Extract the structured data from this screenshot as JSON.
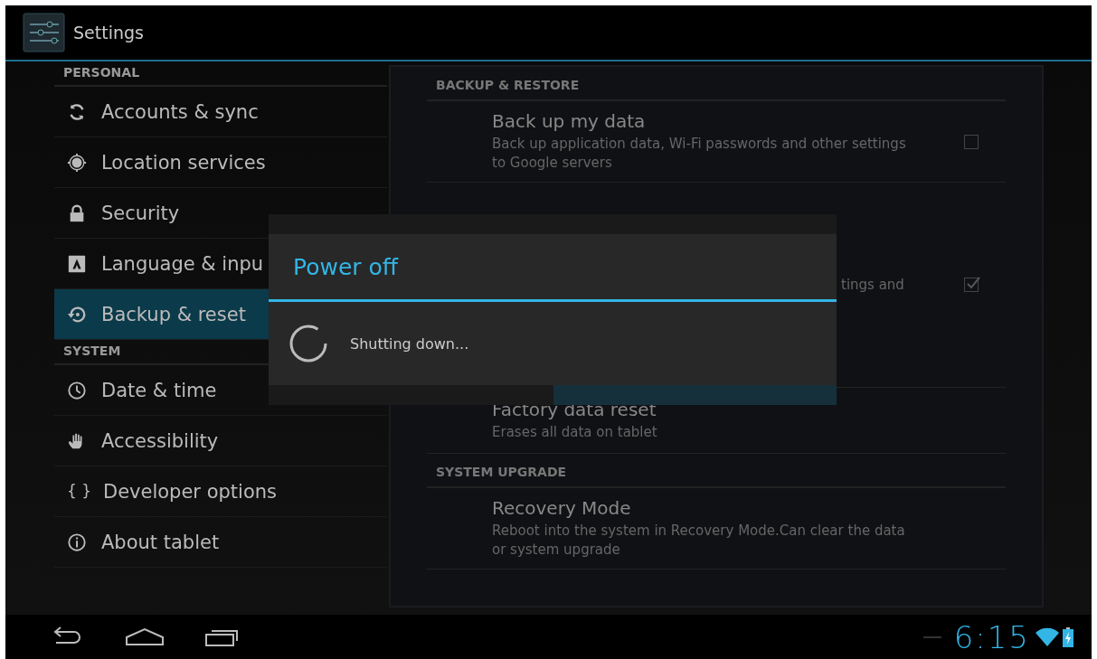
{
  "action_bar": {
    "title": "Settings"
  },
  "sidebar": {
    "sections": [
      {
        "header": "PERSONAL",
        "items": [
          {
            "label": "Accounts & sync",
            "selected": false
          },
          {
            "label": "Location services",
            "selected": false
          },
          {
            "label": "Security",
            "selected": false
          },
          {
            "label": "Language & inpu",
            "selected": false
          },
          {
            "label": "Backup & reset",
            "selected": true
          }
        ]
      },
      {
        "header": "SYSTEM",
        "items": [
          {
            "label": "Date & time",
            "selected": false
          },
          {
            "label": "Accessibility",
            "selected": false
          },
          {
            "glyph": "{ }",
            "label": "Developer options",
            "selected": false
          },
          {
            "label": "About tablet",
            "selected": false
          }
        ]
      }
    ]
  },
  "detail": {
    "sections": [
      {
        "header": "BACKUP & RESTORE",
        "rows": [
          {
            "kind": "checkbox",
            "title": "Back up my data",
            "summary": "Back up application data, Wi-Fi passwords and other settings to Google servers",
            "checked": false
          },
          {
            "kind": "covered",
            "summary": "tings and",
            "checked": true
          },
          {
            "kind": "plain",
            "title": "Factory data reset",
            "summary": "Erases all data on tablet"
          }
        ]
      },
      {
        "header": "SYSTEM UPGRADE",
        "rows": [
          {
            "kind": "plain",
            "title": "Recovery Mode",
            "summary": "Reboot into the system in Recovery Mode.Can clear the data or system upgrade"
          }
        ]
      }
    ]
  },
  "power_dialog": {
    "title": "Power off",
    "message": "Shutting down..."
  },
  "nav_bar": {
    "time": "6:15"
  }
}
